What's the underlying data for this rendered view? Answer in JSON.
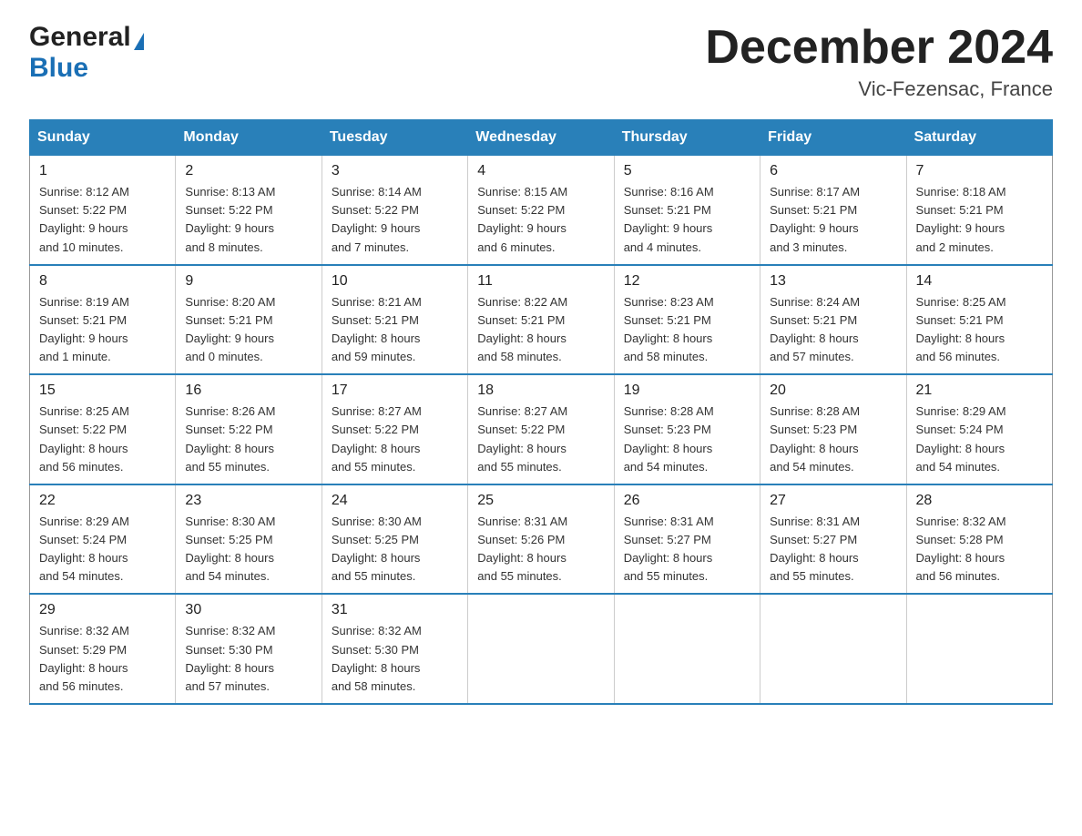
{
  "header": {
    "logo_general": "General",
    "logo_blue": "Blue",
    "month_title": "December 2024",
    "location": "Vic-Fezensac, France"
  },
  "weekdays": [
    "Sunday",
    "Monday",
    "Tuesday",
    "Wednesday",
    "Thursday",
    "Friday",
    "Saturday"
  ],
  "weeks": [
    [
      {
        "day": "1",
        "sunrise": "Sunrise: 8:12 AM",
        "sunset": "Sunset: 5:22 PM",
        "daylight": "Daylight: 9 hours",
        "daylight2": "and 10 minutes."
      },
      {
        "day": "2",
        "sunrise": "Sunrise: 8:13 AM",
        "sunset": "Sunset: 5:22 PM",
        "daylight": "Daylight: 9 hours",
        "daylight2": "and 8 minutes."
      },
      {
        "day": "3",
        "sunrise": "Sunrise: 8:14 AM",
        "sunset": "Sunset: 5:22 PM",
        "daylight": "Daylight: 9 hours",
        "daylight2": "and 7 minutes."
      },
      {
        "day": "4",
        "sunrise": "Sunrise: 8:15 AM",
        "sunset": "Sunset: 5:22 PM",
        "daylight": "Daylight: 9 hours",
        "daylight2": "and 6 minutes."
      },
      {
        "day": "5",
        "sunrise": "Sunrise: 8:16 AM",
        "sunset": "Sunset: 5:21 PM",
        "daylight": "Daylight: 9 hours",
        "daylight2": "and 4 minutes."
      },
      {
        "day": "6",
        "sunrise": "Sunrise: 8:17 AM",
        "sunset": "Sunset: 5:21 PM",
        "daylight": "Daylight: 9 hours",
        "daylight2": "and 3 minutes."
      },
      {
        "day": "7",
        "sunrise": "Sunrise: 8:18 AM",
        "sunset": "Sunset: 5:21 PM",
        "daylight": "Daylight: 9 hours",
        "daylight2": "and 2 minutes."
      }
    ],
    [
      {
        "day": "8",
        "sunrise": "Sunrise: 8:19 AM",
        "sunset": "Sunset: 5:21 PM",
        "daylight": "Daylight: 9 hours",
        "daylight2": "and 1 minute."
      },
      {
        "day": "9",
        "sunrise": "Sunrise: 8:20 AM",
        "sunset": "Sunset: 5:21 PM",
        "daylight": "Daylight: 9 hours",
        "daylight2": "and 0 minutes."
      },
      {
        "day": "10",
        "sunrise": "Sunrise: 8:21 AM",
        "sunset": "Sunset: 5:21 PM",
        "daylight": "Daylight: 8 hours",
        "daylight2": "and 59 minutes."
      },
      {
        "day": "11",
        "sunrise": "Sunrise: 8:22 AM",
        "sunset": "Sunset: 5:21 PM",
        "daylight": "Daylight: 8 hours",
        "daylight2": "and 58 minutes."
      },
      {
        "day": "12",
        "sunrise": "Sunrise: 8:23 AM",
        "sunset": "Sunset: 5:21 PM",
        "daylight": "Daylight: 8 hours",
        "daylight2": "and 58 minutes."
      },
      {
        "day": "13",
        "sunrise": "Sunrise: 8:24 AM",
        "sunset": "Sunset: 5:21 PM",
        "daylight": "Daylight: 8 hours",
        "daylight2": "and 57 minutes."
      },
      {
        "day": "14",
        "sunrise": "Sunrise: 8:25 AM",
        "sunset": "Sunset: 5:21 PM",
        "daylight": "Daylight: 8 hours",
        "daylight2": "and 56 minutes."
      }
    ],
    [
      {
        "day": "15",
        "sunrise": "Sunrise: 8:25 AM",
        "sunset": "Sunset: 5:22 PM",
        "daylight": "Daylight: 8 hours",
        "daylight2": "and 56 minutes."
      },
      {
        "day": "16",
        "sunrise": "Sunrise: 8:26 AM",
        "sunset": "Sunset: 5:22 PM",
        "daylight": "Daylight: 8 hours",
        "daylight2": "and 55 minutes."
      },
      {
        "day": "17",
        "sunrise": "Sunrise: 8:27 AM",
        "sunset": "Sunset: 5:22 PM",
        "daylight": "Daylight: 8 hours",
        "daylight2": "and 55 minutes."
      },
      {
        "day": "18",
        "sunrise": "Sunrise: 8:27 AM",
        "sunset": "Sunset: 5:22 PM",
        "daylight": "Daylight: 8 hours",
        "daylight2": "and 55 minutes."
      },
      {
        "day": "19",
        "sunrise": "Sunrise: 8:28 AM",
        "sunset": "Sunset: 5:23 PM",
        "daylight": "Daylight: 8 hours",
        "daylight2": "and 54 minutes."
      },
      {
        "day": "20",
        "sunrise": "Sunrise: 8:28 AM",
        "sunset": "Sunset: 5:23 PM",
        "daylight": "Daylight: 8 hours",
        "daylight2": "and 54 minutes."
      },
      {
        "day": "21",
        "sunrise": "Sunrise: 8:29 AM",
        "sunset": "Sunset: 5:24 PM",
        "daylight": "Daylight: 8 hours",
        "daylight2": "and 54 minutes."
      }
    ],
    [
      {
        "day": "22",
        "sunrise": "Sunrise: 8:29 AM",
        "sunset": "Sunset: 5:24 PM",
        "daylight": "Daylight: 8 hours",
        "daylight2": "and 54 minutes."
      },
      {
        "day": "23",
        "sunrise": "Sunrise: 8:30 AM",
        "sunset": "Sunset: 5:25 PM",
        "daylight": "Daylight: 8 hours",
        "daylight2": "and 54 minutes."
      },
      {
        "day": "24",
        "sunrise": "Sunrise: 8:30 AM",
        "sunset": "Sunset: 5:25 PM",
        "daylight": "Daylight: 8 hours",
        "daylight2": "and 55 minutes."
      },
      {
        "day": "25",
        "sunrise": "Sunrise: 8:31 AM",
        "sunset": "Sunset: 5:26 PM",
        "daylight": "Daylight: 8 hours",
        "daylight2": "and 55 minutes."
      },
      {
        "day": "26",
        "sunrise": "Sunrise: 8:31 AM",
        "sunset": "Sunset: 5:27 PM",
        "daylight": "Daylight: 8 hours",
        "daylight2": "and 55 minutes."
      },
      {
        "day": "27",
        "sunrise": "Sunrise: 8:31 AM",
        "sunset": "Sunset: 5:27 PM",
        "daylight": "Daylight: 8 hours",
        "daylight2": "and 55 minutes."
      },
      {
        "day": "28",
        "sunrise": "Sunrise: 8:32 AM",
        "sunset": "Sunset: 5:28 PM",
        "daylight": "Daylight: 8 hours",
        "daylight2": "and 56 minutes."
      }
    ],
    [
      {
        "day": "29",
        "sunrise": "Sunrise: 8:32 AM",
        "sunset": "Sunset: 5:29 PM",
        "daylight": "Daylight: 8 hours",
        "daylight2": "and 56 minutes."
      },
      {
        "day": "30",
        "sunrise": "Sunrise: 8:32 AM",
        "sunset": "Sunset: 5:30 PM",
        "daylight": "Daylight: 8 hours",
        "daylight2": "and 57 minutes."
      },
      {
        "day": "31",
        "sunrise": "Sunrise: 8:32 AM",
        "sunset": "Sunset: 5:30 PM",
        "daylight": "Daylight: 8 hours",
        "daylight2": "and 58 minutes."
      },
      null,
      null,
      null,
      null
    ]
  ]
}
